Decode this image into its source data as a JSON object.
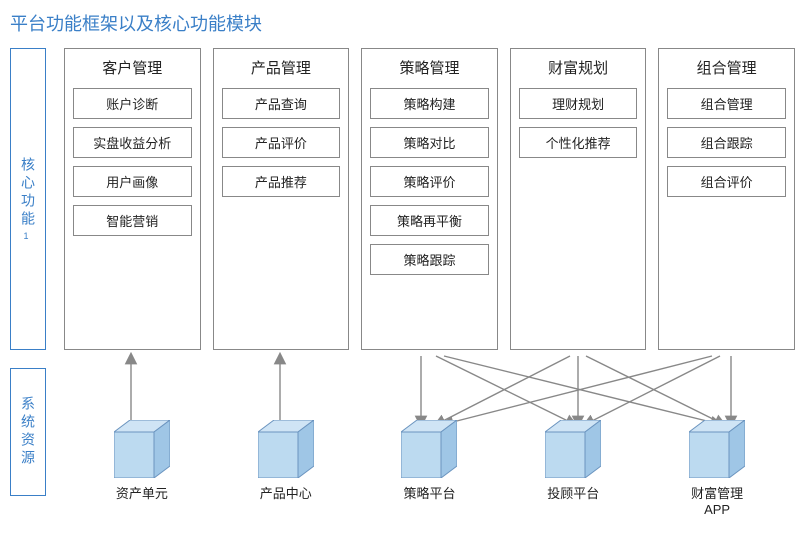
{
  "title": "平台功能框架以及核心功能模块",
  "sideLabels": {
    "core": "核心功能",
    "coreFootnote": "1",
    "sys": "系统资源"
  },
  "modules": [
    {
      "title": "客户管理",
      "items": [
        "账户诊断",
        "实盘收益分析",
        "用户画像",
        "智能营销"
      ]
    },
    {
      "title": "产品管理",
      "items": [
        "产品查询",
        "产品评价",
        "产品推荐"
      ]
    },
    {
      "title": "策略管理",
      "items": [
        "策略构建",
        "策略对比",
        "策略评价",
        "策略再平衡",
        "策略跟踪"
      ]
    },
    {
      "title": "财富规划",
      "items": [
        "理财规划",
        "个性化推荐"
      ]
    },
    {
      "title": "组合管理",
      "items": [
        "组合管理",
        "组合跟踪",
        "组合评价"
      ]
    }
  ],
  "resources": [
    "资产单元",
    "产品中心",
    "策略平台",
    "投顾平台",
    "财富管理\nAPP"
  ]
}
